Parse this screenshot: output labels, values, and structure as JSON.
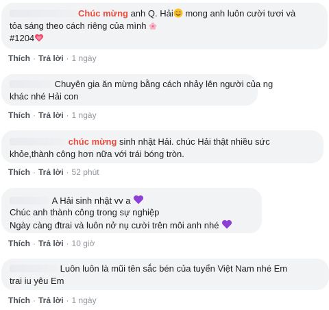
{
  "actions": {
    "like": "Thích",
    "reply": "Trả lời",
    "separator": "·"
  },
  "comments": [
    {
      "highlight": "Chúc mừng",
      "line1_rest": " anh Q. Hải",
      "line1_tail": " mong anh luôn cười tươi và",
      "line2": "tỏa sáng theo cách riêng của mình",
      "line3": "#1204",
      "time": "1 ngày"
    },
    {
      "line1": "Chuyên gia ăn mừng bằng cách nhảy lên người của ng",
      "line2": "khác nhé Hải con",
      "time": "1 ngày"
    },
    {
      "highlight": "chúc mừng",
      "line1_rest": " sinh nhật Hải. chúc Hải thật nhiều sức",
      "line2": "khỏe,thành công hơn nữa với trái bóng tròn.",
      "time": "52 phút"
    },
    {
      "line1": "A Hải sinh nhật vv a",
      "line2": "Chúc anh thành công trong sự nghiệp",
      "line3": "Ngày càng đtrai và luôn nở nụ cười trên môi anh nhé",
      "time": "10 giờ"
    },
    {
      "line1": "Luôn luôn là mũi tên sắc bén của tuyển Việt Nam nhé Em",
      "line2": "trai iu yêu Em",
      "time": "1 ngày"
    }
  ],
  "colors": {
    "bubble": "#f2f3f5",
    "highlight": "#e84c3d",
    "link": "#4b4f56",
    "heart_purple": "#8e3fd6"
  },
  "icons": {
    "smile": "smiling-face-icon",
    "blossom": "cherry-blossom-icon",
    "heart_red": "growing-heart-icon",
    "heart_purple": "purple-heart-icon"
  }
}
